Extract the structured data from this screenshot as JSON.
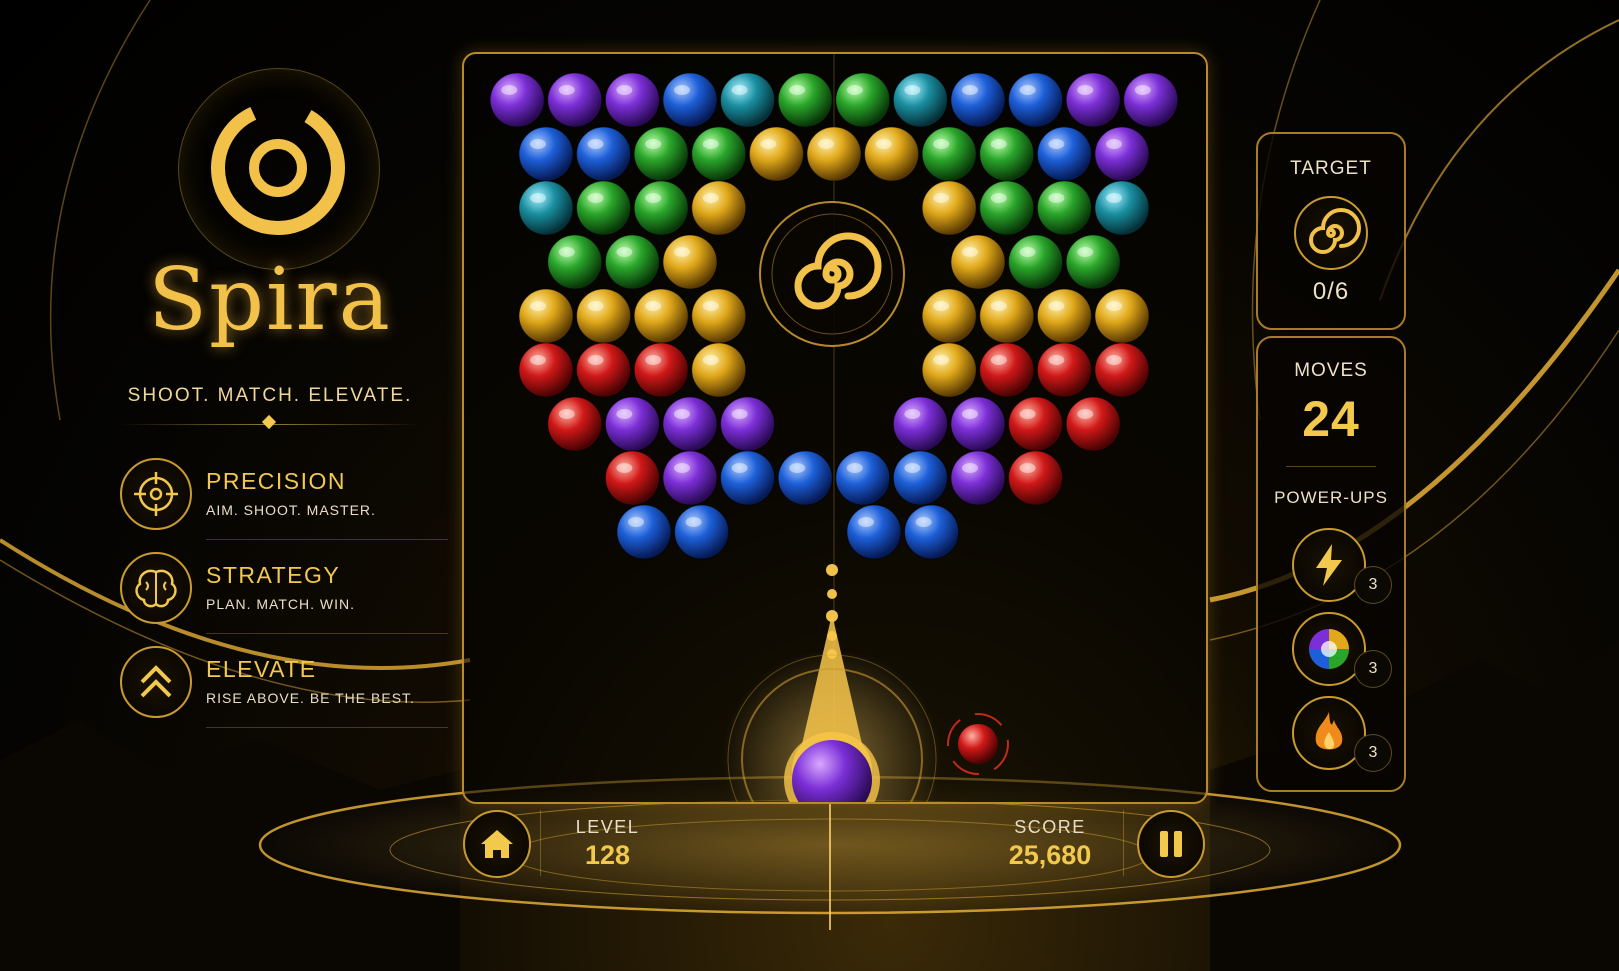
{
  "game": {
    "title": "Spira",
    "tagline": "SHOOT. MATCH. ELEVATE."
  },
  "features": [
    {
      "name": "PRECISION",
      "desc": "AIM. SHOOT. MASTER.",
      "icon": "crosshair-icon"
    },
    {
      "name": "STRATEGY",
      "desc": "PLAN. MATCH. WIN.",
      "icon": "brain-icon"
    },
    {
      "name": "ELEVATE",
      "desc": "RISE ABOVE. BE THE BEST.",
      "icon": "double-chevron-up-icon"
    }
  ],
  "hud": {
    "level_label": "LEVEL",
    "level_value": "128",
    "score_label": "SCORE",
    "score_value": "25,680"
  },
  "target": {
    "label": "TARGET",
    "progress": "0/6",
    "icon": "spiral-icon"
  },
  "moves": {
    "label": "MOVES",
    "value": "24"
  },
  "powerups": {
    "label": "POWER-UPS",
    "items": [
      {
        "icon": "lightning-icon",
        "count": "3"
      },
      {
        "icon": "rainbow-orb-icon",
        "count": "3"
      },
      {
        "icon": "fire-icon",
        "count": "3"
      }
    ]
  },
  "shooter": {
    "current_ball": "purple",
    "next_ball": "red"
  },
  "colors": {
    "gold": "#f2c94c",
    "purple": "#7b2fd6",
    "blue": "#1d5fd8",
    "teal": "#1a8fa0",
    "green": "#2aa52a",
    "yellow": "#e0a81a",
    "red": "#d01818"
  },
  "bubble_rows": [
    [
      "purple",
      "purple",
      "purple",
      "blue",
      "teal",
      "green",
      "green",
      "teal",
      "blue",
      "blue",
      "purple",
      "purple"
    ],
    [
      "blue",
      "blue",
      "green",
      "green",
      "yellow",
      "yellow",
      "yellow",
      "green",
      "green",
      "blue",
      "purple"
    ],
    [
      "teal",
      "green",
      "green",
      "yellow",
      "",
      "",
      "",
      "yellow",
      "green",
      "green",
      "teal"
    ],
    [
      "green",
      "green",
      "yellow",
      "",
      "",
      "",
      "",
      "yellow",
      "green",
      "green"
    ],
    [
      "yellow",
      "yellow",
      "yellow",
      "yellow",
      "",
      "",
      "",
      "yellow",
      "yellow",
      "yellow",
      "yellow"
    ],
    [
      "red",
      "red",
      "red",
      "yellow",
      "",
      "",
      "",
      "yellow",
      "red",
      "red",
      "red"
    ],
    [
      "red",
      "purple",
      "purple",
      "purple",
      "",
      "",
      "purple",
      "purple",
      "red",
      "red"
    ],
    [
      "red",
      "purple",
      "blue",
      "blue",
      "blue",
      "blue",
      "purple",
      "red"
    ],
    [
      "blue",
      "blue",
      "",
      "blue",
      "blue"
    ]
  ]
}
